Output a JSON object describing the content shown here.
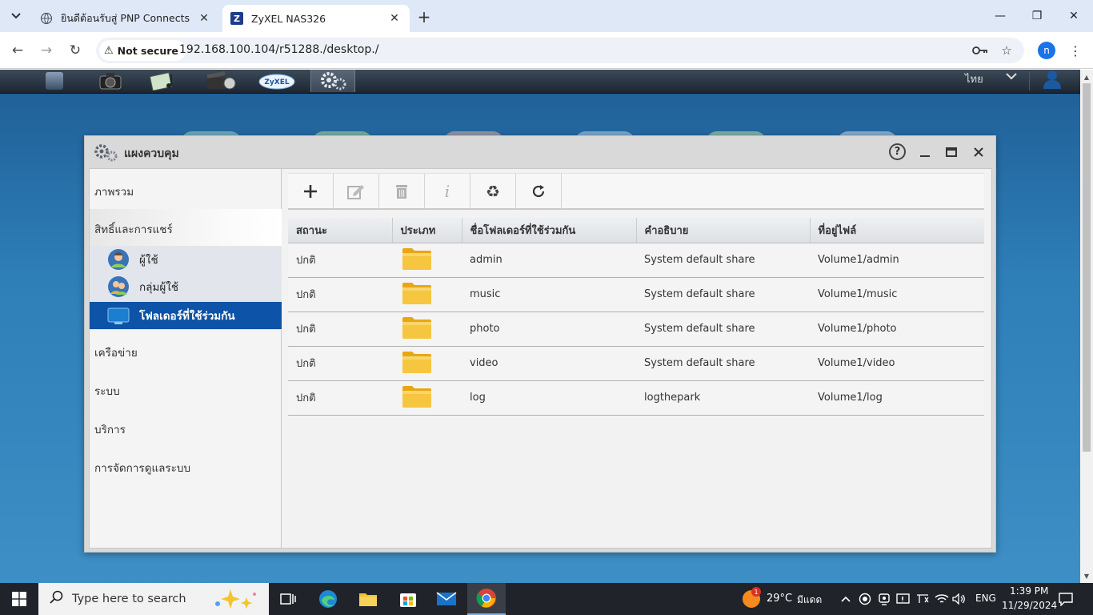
{
  "browser": {
    "tabs": [
      {
        "title": "ยินดีต้อนรับสู่ PNP Connects",
        "active": false
      },
      {
        "title": "ZyXEL NAS326",
        "active": true
      }
    ],
    "security_label": "Not secure",
    "url": "192.168.100.104/r51288./desktop./",
    "profile_initial": "n"
  },
  "appbar": {
    "language": "ไทย"
  },
  "control_panel": {
    "title": "แผงควบคุม",
    "help": "?",
    "sidebar": {
      "categories": [
        {
          "label": "ภาพรวม"
        },
        {
          "label": "สิทธิ์และการแชร์"
        },
        {
          "label": "เครือข่าย"
        },
        {
          "label": "ระบบ"
        },
        {
          "label": "บริการ"
        },
        {
          "label": "การจัดการดูแลระบบ"
        }
      ],
      "sub_items": [
        {
          "label": "ผู้ใช้"
        },
        {
          "label": "กลุ่มผู้ใช้"
        },
        {
          "label": "โฟลเดอร์ที่ใช้ร่วมกัน",
          "selected": true
        }
      ]
    },
    "toolbar": {
      "add": "+",
      "edit": "✎",
      "delete": "🗑",
      "info": "i",
      "recycle": "♻",
      "refresh": "↻"
    },
    "table": {
      "columns": [
        "สถานะ",
        "ประเภท",
        "ชื่อโฟลเดอร์ที่ใช้ร่วมกัน",
        "คำอธิบาย",
        "ที่อยู่ไฟล์"
      ],
      "rows": [
        {
          "status": "ปกติ",
          "type": "folder",
          "name": "admin",
          "description": "System default share",
          "path": "Volume1/admin"
        },
        {
          "status": "ปกติ",
          "type": "folder",
          "name": "music",
          "description": "System default share",
          "path": "Volume1/music"
        },
        {
          "status": "ปกติ",
          "type": "folder",
          "name": "photo",
          "description": "System default share",
          "path": "Volume1/photo"
        },
        {
          "status": "ปกติ",
          "type": "folder",
          "name": "video",
          "description": "System default share",
          "path": "Volume1/video"
        },
        {
          "status": "ปกติ",
          "type": "folder",
          "name": "log",
          "description": "logthepark",
          "path": "Volume1/log"
        }
      ]
    }
  },
  "taskbar": {
    "search_placeholder": "Type here to search",
    "weather_temp": "29°C",
    "weather_desc": "มีแดด",
    "weather_badge": "1",
    "language": "ENG",
    "time": "1:39 PM",
    "date": "11/29/2024"
  },
  "colors": {
    "selection": "#0d53a7",
    "desktop_blue": "#2e7eb8",
    "folder_yellow": "#f2b51c",
    "taskbar": "#20232a"
  }
}
